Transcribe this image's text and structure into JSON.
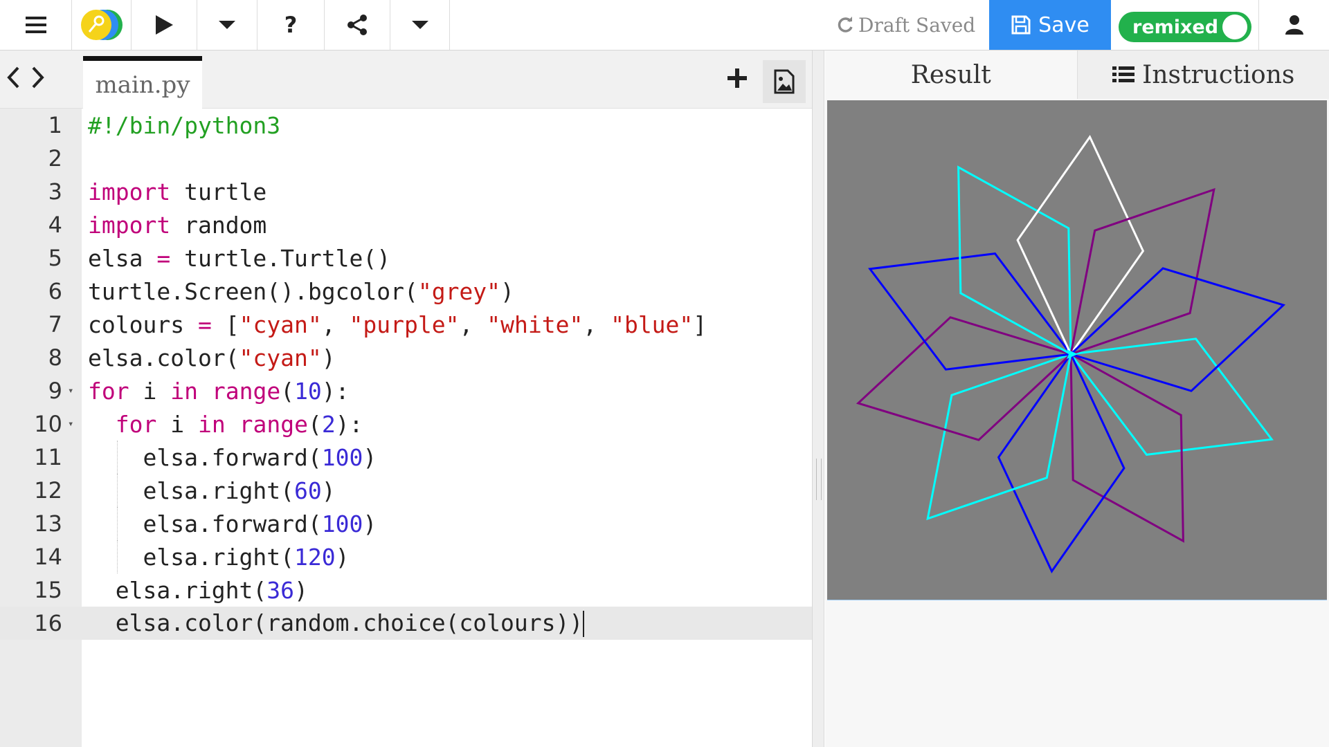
{
  "toolbar": {
    "menu_icon": "hamburger-menu-icon",
    "logo_icon": "trinket-logo-icon",
    "run_icon": "play-icon",
    "help_label": "?",
    "share_icon": "share-icon",
    "draft_status": "Draft Saved",
    "save_label": "Save",
    "remix_label": "remixed",
    "user_icon": "user-icon",
    "colors": {
      "save": "#2f8df2",
      "remix": "#22b14c"
    }
  },
  "editor": {
    "file_tab": "main.py",
    "lines": [
      {
        "n": "1",
        "html": "<span class=\"tok-cm\">#!/bin/python3</span>"
      },
      {
        "n": "2",
        "html": ""
      },
      {
        "n": "3",
        "html": "<span class=\"tok-kw\">import</span> turtle"
      },
      {
        "n": "4",
        "html": "<span class=\"tok-kw\">import</span> random"
      },
      {
        "n": "5",
        "html": "elsa <span class=\"tok-op\">=</span> turtle.Turtle()"
      },
      {
        "n": "6",
        "html": "turtle.Screen().bgcolor(<span class=\"tok-str\">\"grey\"</span>)"
      },
      {
        "n": "7",
        "html": "colours <span class=\"tok-op\">=</span> [<span class=\"tok-str\">\"cyan\"</span>, <span class=\"tok-str\">\"purple\"</span>, <span class=\"tok-str\">\"white\"</span>, <span class=\"tok-str\">\"blue\"</span>]"
      },
      {
        "n": "8",
        "html": "elsa.color(<span class=\"tok-str\">\"cyan\"</span>)"
      },
      {
        "n": "9",
        "html": "<span class=\"tok-kw\">for</span> i <span class=\"tok-kw\">in</span> <span class=\"tok-kw\">range</span>(<span class=\"tok-num\">10</span>):",
        "fold": true
      },
      {
        "n": "10",
        "html": "  <span class=\"tok-kw\">for</span> i <span class=\"tok-kw\">in</span> <span class=\"tok-kw\">range</span>(<span class=\"tok-num\">2</span>):",
        "fold": true
      },
      {
        "n": "11",
        "html": "    elsa.forward(<span class=\"tok-num\">100</span>)",
        "guide": true
      },
      {
        "n": "12",
        "html": "    elsa.right(<span class=\"tok-num\">60</span>)",
        "guide": true
      },
      {
        "n": "13",
        "html": "    elsa.forward(<span class=\"tok-num\">100</span>)",
        "guide": true
      },
      {
        "n": "14",
        "html": "    elsa.right(<span class=\"tok-num\">120</span>)",
        "guide": true
      },
      {
        "n": "15",
        "html": "  elsa.right(<span class=\"tok-num\">36</span>)"
      },
      {
        "n": "16",
        "html": "  elsa.color(random.choice(colours))<span class=\"cursor\"></span>",
        "active": true
      }
    ]
  },
  "result": {
    "tab_result": "Result",
    "tab_instructions": "Instructions",
    "canvas_bg": "#808080",
    "shape": {
      "petals": 10,
      "turn_deg": 36,
      "colors": [
        "cyan",
        "purple",
        "blue",
        "cyan",
        "purple",
        "blue",
        "cyan",
        "white",
        "purple",
        "blue"
      ]
    }
  }
}
